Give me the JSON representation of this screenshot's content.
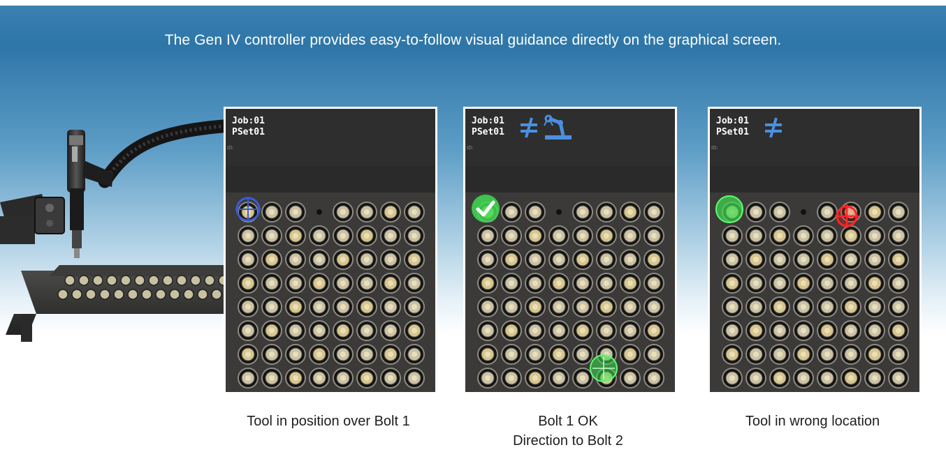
{
  "headline": "The Gen IV controller provides easy-to-follow visual guidance directly on the graphical screen.",
  "colors": {
    "banner_top": "#2e76a8",
    "target_blue": "#3b5bd6",
    "ok_green": "#3fdc52",
    "error_red": "#ff2424",
    "icon_blue": "#4a90e2"
  },
  "screens": [
    {
      "job": "Job:01",
      "pset": "PSet01",
      "id_label": "ID:",
      "status_icons": [],
      "caption_lines": [
        "Tool in position over Bolt 1"
      ]
    },
    {
      "job": "Job:01",
      "pset": "PSet01",
      "id_label": "ID:",
      "status_icons": [
        "not-equal-icon",
        "robot-arm-icon"
      ],
      "caption_lines": [
        "Bolt 1 OK",
        "Direction to Bolt 2"
      ]
    },
    {
      "job": "Job:01",
      "pset": "PSet01",
      "id_label": "ID:",
      "status_icons": [
        "not-equal-icon"
      ],
      "caption_lines": [
        "Tool in wrong location"
      ]
    }
  ]
}
